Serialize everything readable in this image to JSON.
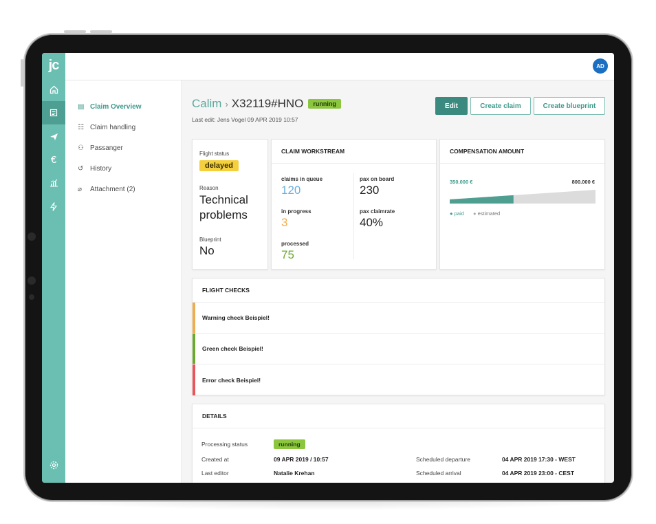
{
  "app": {
    "logo": "jc",
    "avatar_initials": "AD"
  },
  "rail_icons": [
    "home-icon",
    "document-icon",
    "plane-icon",
    "euro-icon",
    "chart-icon",
    "bolt-icon",
    "settings-icon"
  ],
  "subnav": {
    "items": [
      {
        "label": "Claim Overview",
        "icon": "overview-icon"
      },
      {
        "label": "Claim handling",
        "icon": "handling-icon"
      },
      {
        "label": "Passanger",
        "icon": "people-icon"
      },
      {
        "label": "History",
        "icon": "history-icon"
      },
      {
        "label": "Attachment (2)",
        "icon": "paperclip-icon"
      }
    ]
  },
  "header": {
    "breadcrumb_root": "Calim",
    "separator": "›",
    "claim_id": "X32119#HNO",
    "status": "running",
    "last_edit": "Last edit: Jens Vogel 09 APR 2019 10:57"
  },
  "actions": {
    "edit": "Edit",
    "create_claim": "Create claim",
    "create_blueprint": "Create blueprint"
  },
  "flight_status": {
    "status_label": "Flight status",
    "status_value": "delayed",
    "reason_label": "Reason",
    "reason_value": "Technical problems",
    "blueprint_label": "Blueprint",
    "blueprint_value": "No"
  },
  "workstream": {
    "title": "CLAIM WORKSTREAM",
    "queue_label": "claims in queue",
    "queue_value": "120",
    "progress_label": "in progress",
    "progress_value": "3",
    "processed_label": "processed",
    "processed_value": "75",
    "pax_label": "pax on board",
    "pax_value": "230",
    "claimrate_label": "pax claimrate",
    "claimrate_value": "40%"
  },
  "compensation": {
    "title": "COMPENSATION AMOUNT",
    "paid_amount": "350.000 €",
    "estimated_amount": "800.000 €",
    "paid_fraction": 0.4375,
    "legend_paid": "paid",
    "legend_estimated": "estimated",
    "colors": {
      "paid": "#4e9f8f",
      "estimated": "#dcdcdc"
    }
  },
  "checks": {
    "title": "FLIGHT CHECKS",
    "items": [
      {
        "label": "Warning check Beispiel!",
        "color": "#f0ad4e"
      },
      {
        "label": "Green check Beispiel!",
        "color": "#6aa82e"
      },
      {
        "label": "Error check Beispiel!",
        "color": "#e8555a"
      }
    ]
  },
  "details": {
    "title": "DETAILS",
    "processing_status_label": "Processing status",
    "processing_status_value": "running",
    "created_label": "Created at",
    "created_value": "09 APR 2019 / 10:57",
    "editor_label": "Last editor",
    "editor_value": "Natalie Krehan",
    "departure_label": "Scheduled departure",
    "departure_value": "04 APR 2019 17:30 - WEST",
    "arrival_label": "Scheduled arrival",
    "arrival_value": "04 APR 2019 23:00 - CEST"
  },
  "colors": {
    "accent": "#6bbfb2",
    "accent_dark": "#3b8a7f",
    "queue": "#6aaee0",
    "progress": "#f0ad4e",
    "processed": "#6aa82e"
  }
}
